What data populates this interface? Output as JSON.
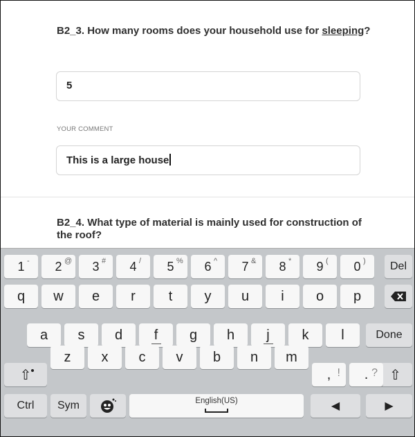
{
  "question1": {
    "text_before": "B2_3. How many rooms does your household use for ",
    "text_underlined": "sleeping",
    "text_after": "?"
  },
  "answer1": {
    "value": "5"
  },
  "comment": {
    "label": "YOUR COMMENT",
    "value": "This is a large house"
  },
  "question2": {
    "text": "B2_4. What type of material is mainly used for construction of the roof?"
  },
  "keyboard": {
    "row1": [
      {
        "label": "1",
        "sup": "-"
      },
      {
        "label": "2",
        "sup": "@"
      },
      {
        "label": "3",
        "sup": "#"
      },
      {
        "label": "4",
        "sup": "/"
      },
      {
        "label": "5",
        "sup": "%"
      },
      {
        "label": "6",
        "sup": "^"
      },
      {
        "label": "7",
        "sup": "&"
      },
      {
        "label": "8",
        "sup": "*"
      },
      {
        "label": "9",
        "sup": "("
      },
      {
        "label": "0",
        "sup": ")"
      }
    ],
    "del": "Del",
    "row2": [
      "q",
      "w",
      "e",
      "r",
      "t",
      "y",
      "u",
      "i",
      "o",
      "p"
    ],
    "backspace_icon": "backspace-icon",
    "row3": [
      "a",
      "s",
      "d",
      "f",
      "g",
      "h",
      "j",
      "k",
      "l"
    ],
    "done": "Done",
    "row4": [
      "z",
      "x",
      "c",
      "v",
      "b",
      "n",
      "m"
    ],
    "comma": ",",
    "comma_hint": "!",
    "period": ".",
    "period_hint": "?",
    "shift_icon": "shift-icon",
    "ctrl": "Ctrl",
    "sym": "Sym",
    "emoji_icon": "emoji-icon",
    "space_label": "English(US)",
    "left_arrow_icon": "left-arrow-icon",
    "right_arrow_icon": "right-arrow-icon"
  }
}
